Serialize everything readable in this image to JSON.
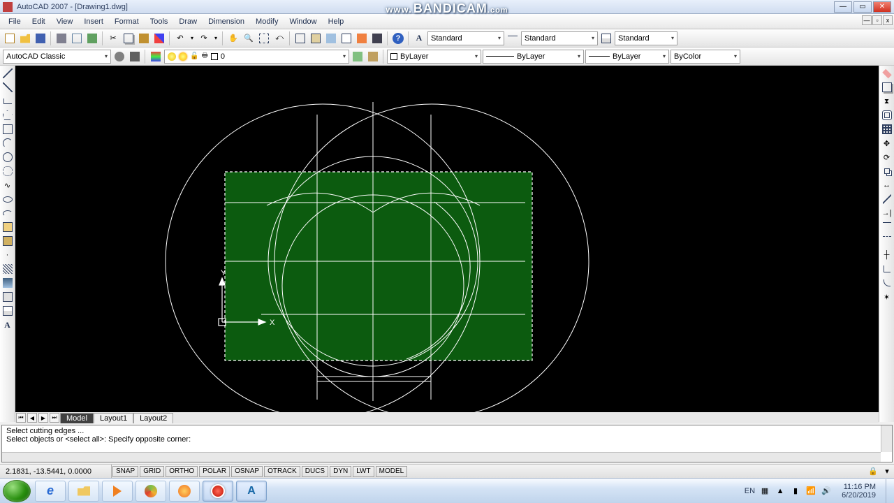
{
  "window": {
    "title": "AutoCAD 2007 - [Drawing1.dwg]"
  },
  "watermark": "www.BANDICAM.com",
  "menu": [
    "File",
    "Edit",
    "View",
    "Insert",
    "Format",
    "Tools",
    "Draw",
    "Dimension",
    "Modify",
    "Window",
    "Help"
  ],
  "workspace_selector": "AutoCAD Classic",
  "style_bars": {
    "text_style": "Standard",
    "dim_style": "Standard",
    "table_style": "Standard"
  },
  "layer_bar": {
    "layer": "0",
    "linetype": "ByLayer",
    "lineweight": "ByLayer",
    "color": "ByColor"
  },
  "tabs": {
    "model": "Model",
    "layout1": "Layout1",
    "layout2": "Layout2"
  },
  "command": {
    "line1": "Select cutting edges ...",
    "line2": "Select objects or <select all>: Specify opposite corner:"
  },
  "status": {
    "coords": "2.1831, -13.5441, 0.0000",
    "buttons": [
      "SNAP",
      "GRID",
      "ORTHO",
      "POLAR",
      "OSNAP",
      "OTRACK",
      "DUCS",
      "DYN",
      "LWT",
      "MODEL"
    ],
    "lang": "EN"
  },
  "taskbar": {
    "time": "11:16 PM",
    "date": "6/20/2019"
  },
  "ucs": {
    "y": "Y",
    "x": "X"
  }
}
